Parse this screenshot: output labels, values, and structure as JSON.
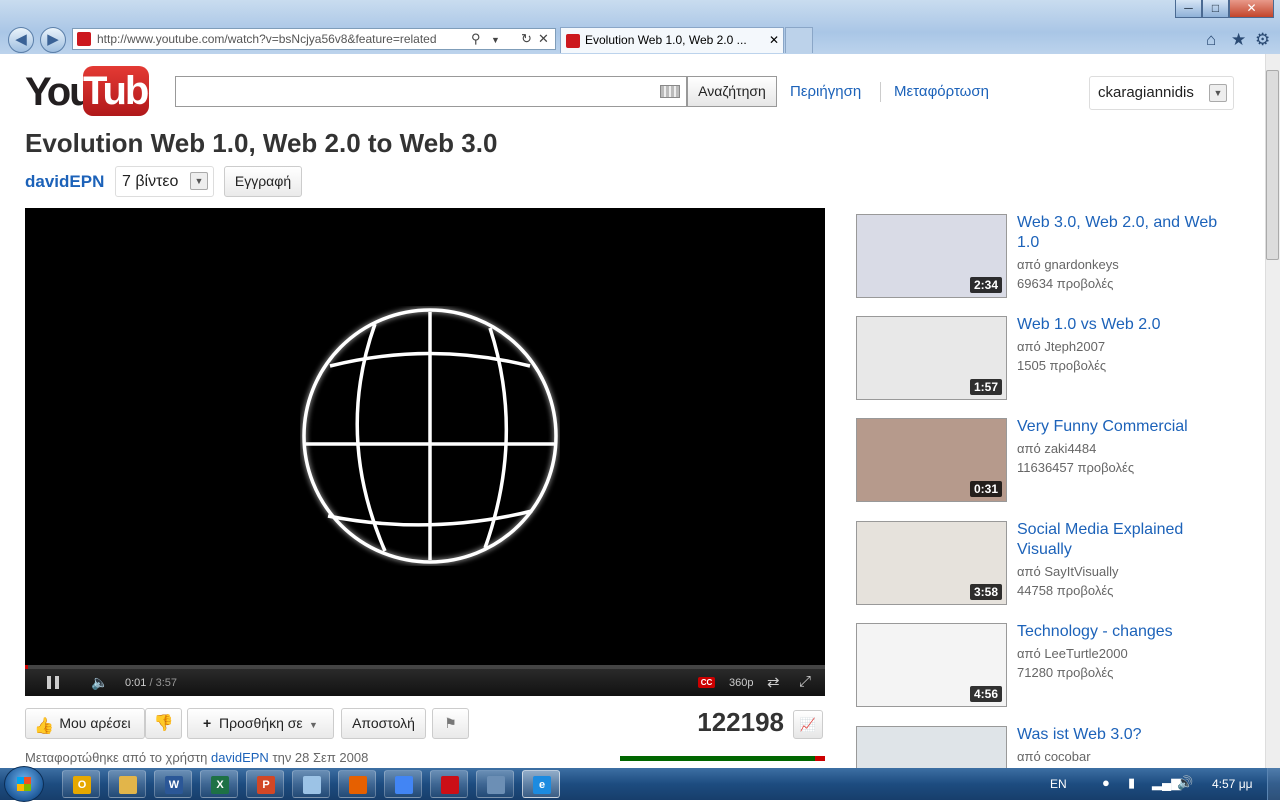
{
  "browser": {
    "url": "http://www.youtube.com/watch?v=bsNcjya56v8&feature=related",
    "tab_title": "Evolution Web 1.0, Web 2.0 ...",
    "tab_close": "✕",
    "addr_search": "⚲",
    "addr_refresh": "↻",
    "addr_stop": "✕",
    "minimize": "─",
    "maximize": "□",
    "close": "✕",
    "home_icon": "⌂",
    "favorites_icon": "★",
    "tools_icon": "⚙"
  },
  "header": {
    "logo_you": "You",
    "logo_tube": "Tube",
    "search_placeholder": "",
    "search_button": "Αναζήτηση",
    "browse_link": "Περιήγηση",
    "upload_link": "Μεταφόρτωση",
    "username": "ckaragiannidis"
  },
  "video": {
    "title": "Evolution Web 1.0, Web 2.0 to Web 3.0",
    "channel": "davidEPN",
    "video_count": "7 βίντεο",
    "subscribe": "Εγγραφή",
    "current_time": "0:01",
    "total_time": "/ 3:57",
    "progress": 0.004,
    "cc": "CC",
    "quality": "360p",
    "like": "Μου αρέσει",
    "add_to": "Προσθήκη σε",
    "share": "Αποστολή",
    "views": "122198",
    "upload_prefix": "Μεταφορτώθηκε από το χρήστη",
    "upload_user": "davidEPN",
    "upload_date": "την 28 Σεπ 2008",
    "likes_ratio": 0.95
  },
  "related": [
    {
      "title": "Web 3.0, Web 2.0, and Web 1.0",
      "author": "από gnardonkeys",
      "views": "69634 προβολές",
      "duration": "2:34",
      "color": "#d9dbe6"
    },
    {
      "title": "Web 1.0 vs Web 2.0",
      "author": "από Jteph2007",
      "views": "1505 προβολές",
      "duration": "1:57",
      "color": "#e8e8e8"
    },
    {
      "title": "Very Funny Commercial",
      "author": "από zaki4484",
      "views": "11636457 προβολές",
      "duration": "0:31",
      "color": "#b69a8c"
    },
    {
      "title": "Social Media Explained Visually",
      "author": "από SayItVisually",
      "views": "44758 προβολές",
      "duration": "3:58",
      "color": "#e6e2dc"
    },
    {
      "title": "Technology - changes",
      "author": "από LeeTurtle2000",
      "views": "71280 προβολές",
      "duration": "4:56",
      "color": "#f4f4f4"
    },
    {
      "title": "Was ist Web 3.0?",
      "author": "από cocobar",
      "views": "",
      "duration": "",
      "color": "#dfe4e8"
    }
  ],
  "taskbar": {
    "language": "EN",
    "clock": "4:57 μμ",
    "apps": [
      {
        "name": "outlook",
        "letter": "O",
        "color": "#e6a800"
      },
      {
        "name": "explorer",
        "letter": "",
        "color": "#e2b54a"
      },
      {
        "name": "word",
        "letter": "W",
        "color": "#2b5797"
      },
      {
        "name": "excel",
        "letter": "X",
        "color": "#1e7145"
      },
      {
        "name": "powerpoint",
        "letter": "P",
        "color": "#d24726"
      },
      {
        "name": "notepad",
        "letter": "",
        "color": "#9cc3e6"
      },
      {
        "name": "firefox",
        "letter": "",
        "color": "#e66000"
      },
      {
        "name": "chrome",
        "letter": "",
        "color": "#4285f4"
      },
      {
        "name": "opera",
        "letter": "",
        "color": "#cc0f16"
      },
      {
        "name": "app",
        "letter": "",
        "color": "#6c8fb5"
      },
      {
        "name": "internet-explorer",
        "letter": "e",
        "color": "#1c8be0"
      }
    ]
  }
}
